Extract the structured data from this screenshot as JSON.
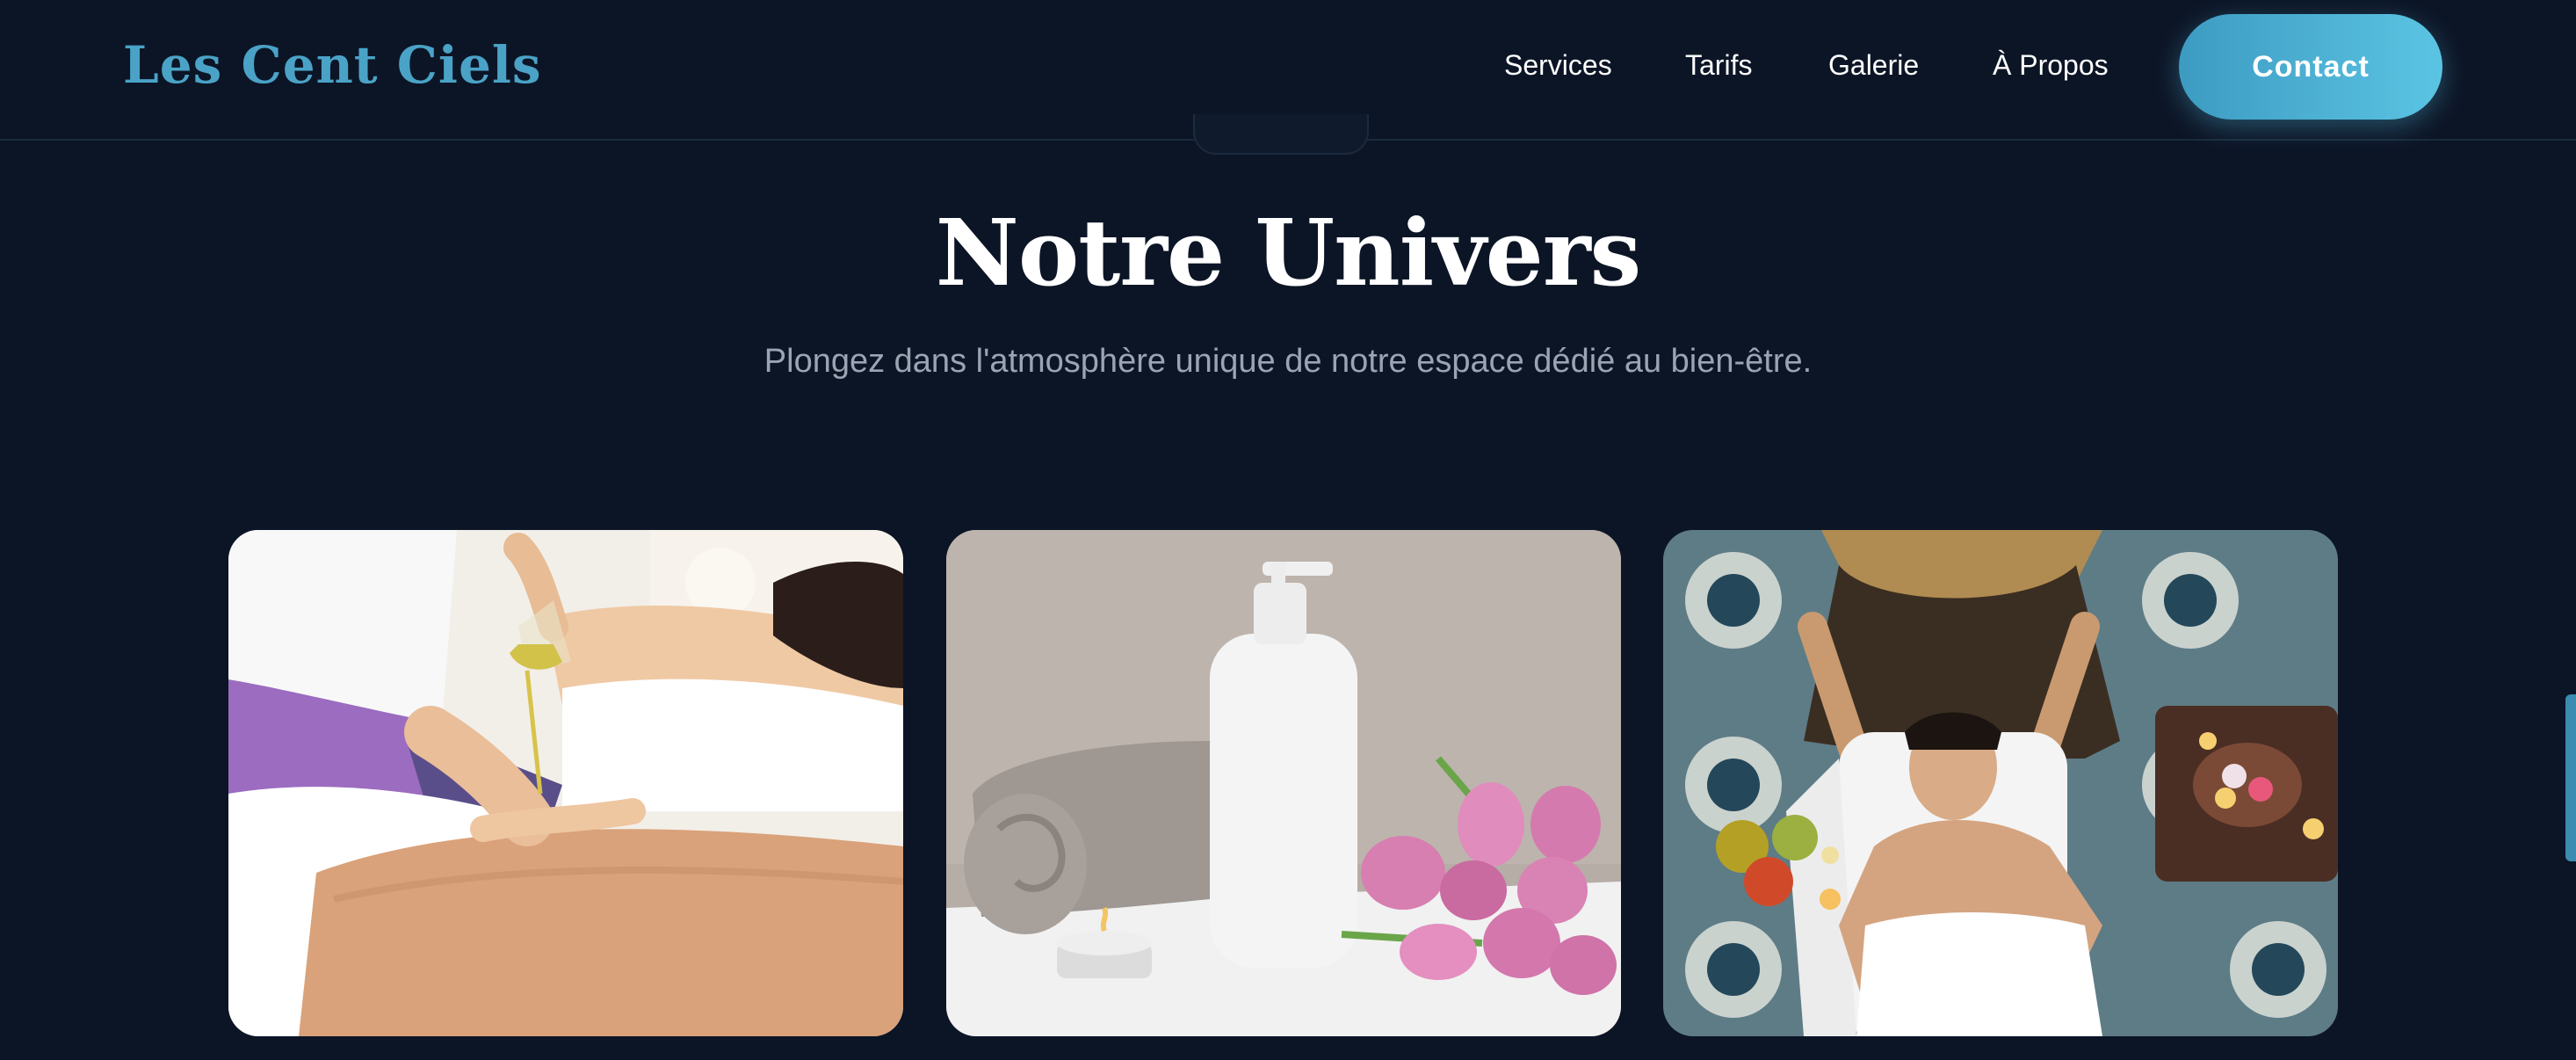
{
  "header": {
    "logo": "Les Cent Ciels",
    "nav": [
      {
        "label": "Services"
      },
      {
        "label": "Tarifs"
      },
      {
        "label": "Galerie"
      },
      {
        "label": "À Propos"
      }
    ],
    "contact_label": "Contact"
  },
  "section": {
    "title": "Notre Univers",
    "subtitle": "Plongez dans l'atmosphère unique de notre espace dédié au bien-être."
  },
  "gallery": [
    {
      "icon": "oil-massage-photo"
    },
    {
      "icon": "spa-towel-bottle-tulips-photo"
    },
    {
      "icon": "head-massage-photo"
    }
  ],
  "colors": {
    "background": "#0c1526",
    "accent": "#4aa3c7",
    "button_gradient_start": "#3d9bc2",
    "button_gradient_end": "#5bc4e3",
    "subtitle_text": "#9aa4b2"
  }
}
